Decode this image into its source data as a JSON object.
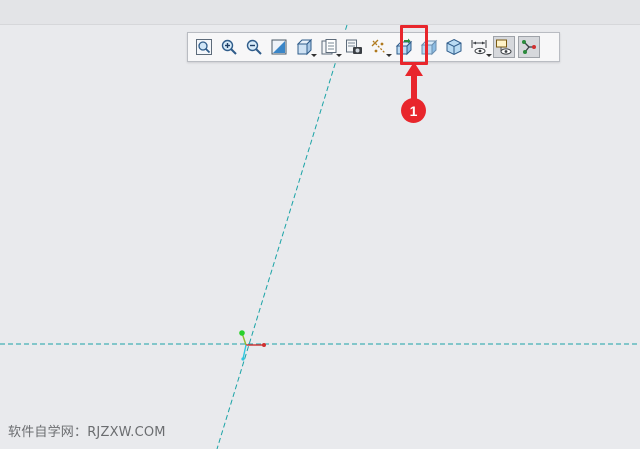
{
  "toolbar": {
    "items": [
      {
        "icon": "zoom-fit-icon"
      },
      {
        "icon": "zoom-in-icon"
      },
      {
        "icon": "zoom-out-icon"
      },
      {
        "icon": "repaint-icon"
      },
      {
        "icon": "view-orientation-icon",
        "menu": true
      },
      {
        "icon": "saved-views-icon",
        "menu": true
      },
      {
        "icon": "display-style-icon"
      },
      {
        "icon": "datum-display-icon",
        "menu": true
      },
      {
        "icon": "sketch-view-icon",
        "highlighted": true
      },
      {
        "icon": "shaded-view-icon"
      },
      {
        "icon": "shaded-edges-icon"
      },
      {
        "icon": "dimension-display-icon",
        "menu": true
      },
      {
        "icon": "hidden-line-icon",
        "active": true
      },
      {
        "icon": "constraint-display-icon",
        "active": true
      }
    ]
  },
  "annotation": {
    "step_number": "1",
    "color": "#e8262c"
  },
  "watermark": {
    "text": "软件自学网：RJZXW.COM"
  },
  "colors": {
    "background": "#e9eaed",
    "centerline": "#1aa3a6",
    "accent": "#e8262c"
  }
}
